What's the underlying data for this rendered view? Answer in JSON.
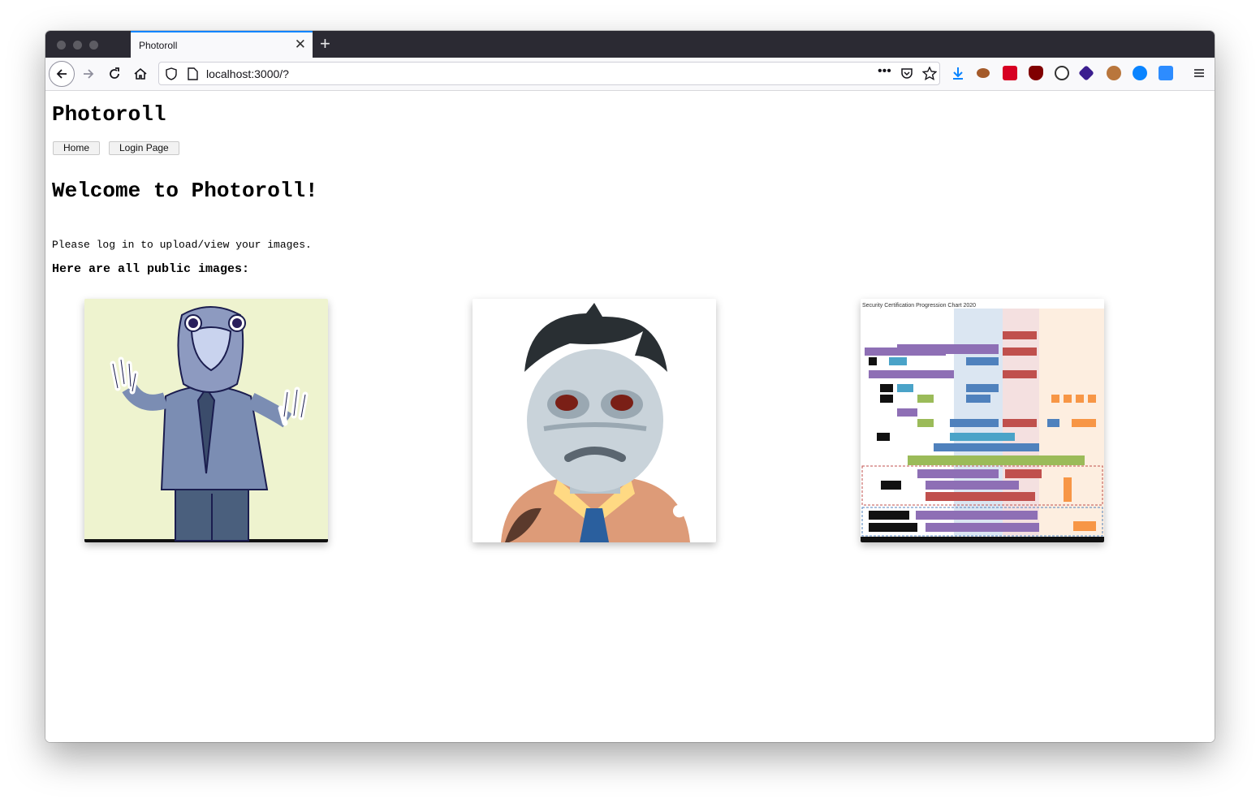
{
  "browser": {
    "tab_title": "Photoroll",
    "tab_close": "✕",
    "new_tab": "+",
    "url": "localhost:3000/?"
  },
  "page": {
    "site_title": "Photoroll",
    "nav": [
      "Home",
      "Login Page"
    ],
    "heading": "Welcome to Photoroll!",
    "message": "Please log in to upload/view your images.",
    "subheading": "Here are all public images:",
    "images": [
      {
        "alt": "bird-person-illustration"
      },
      {
        "alt": "zombie-emoji"
      },
      {
        "alt": "security-certification-chart",
        "caption": "Security Certification Progression Chart 2020"
      }
    ]
  }
}
